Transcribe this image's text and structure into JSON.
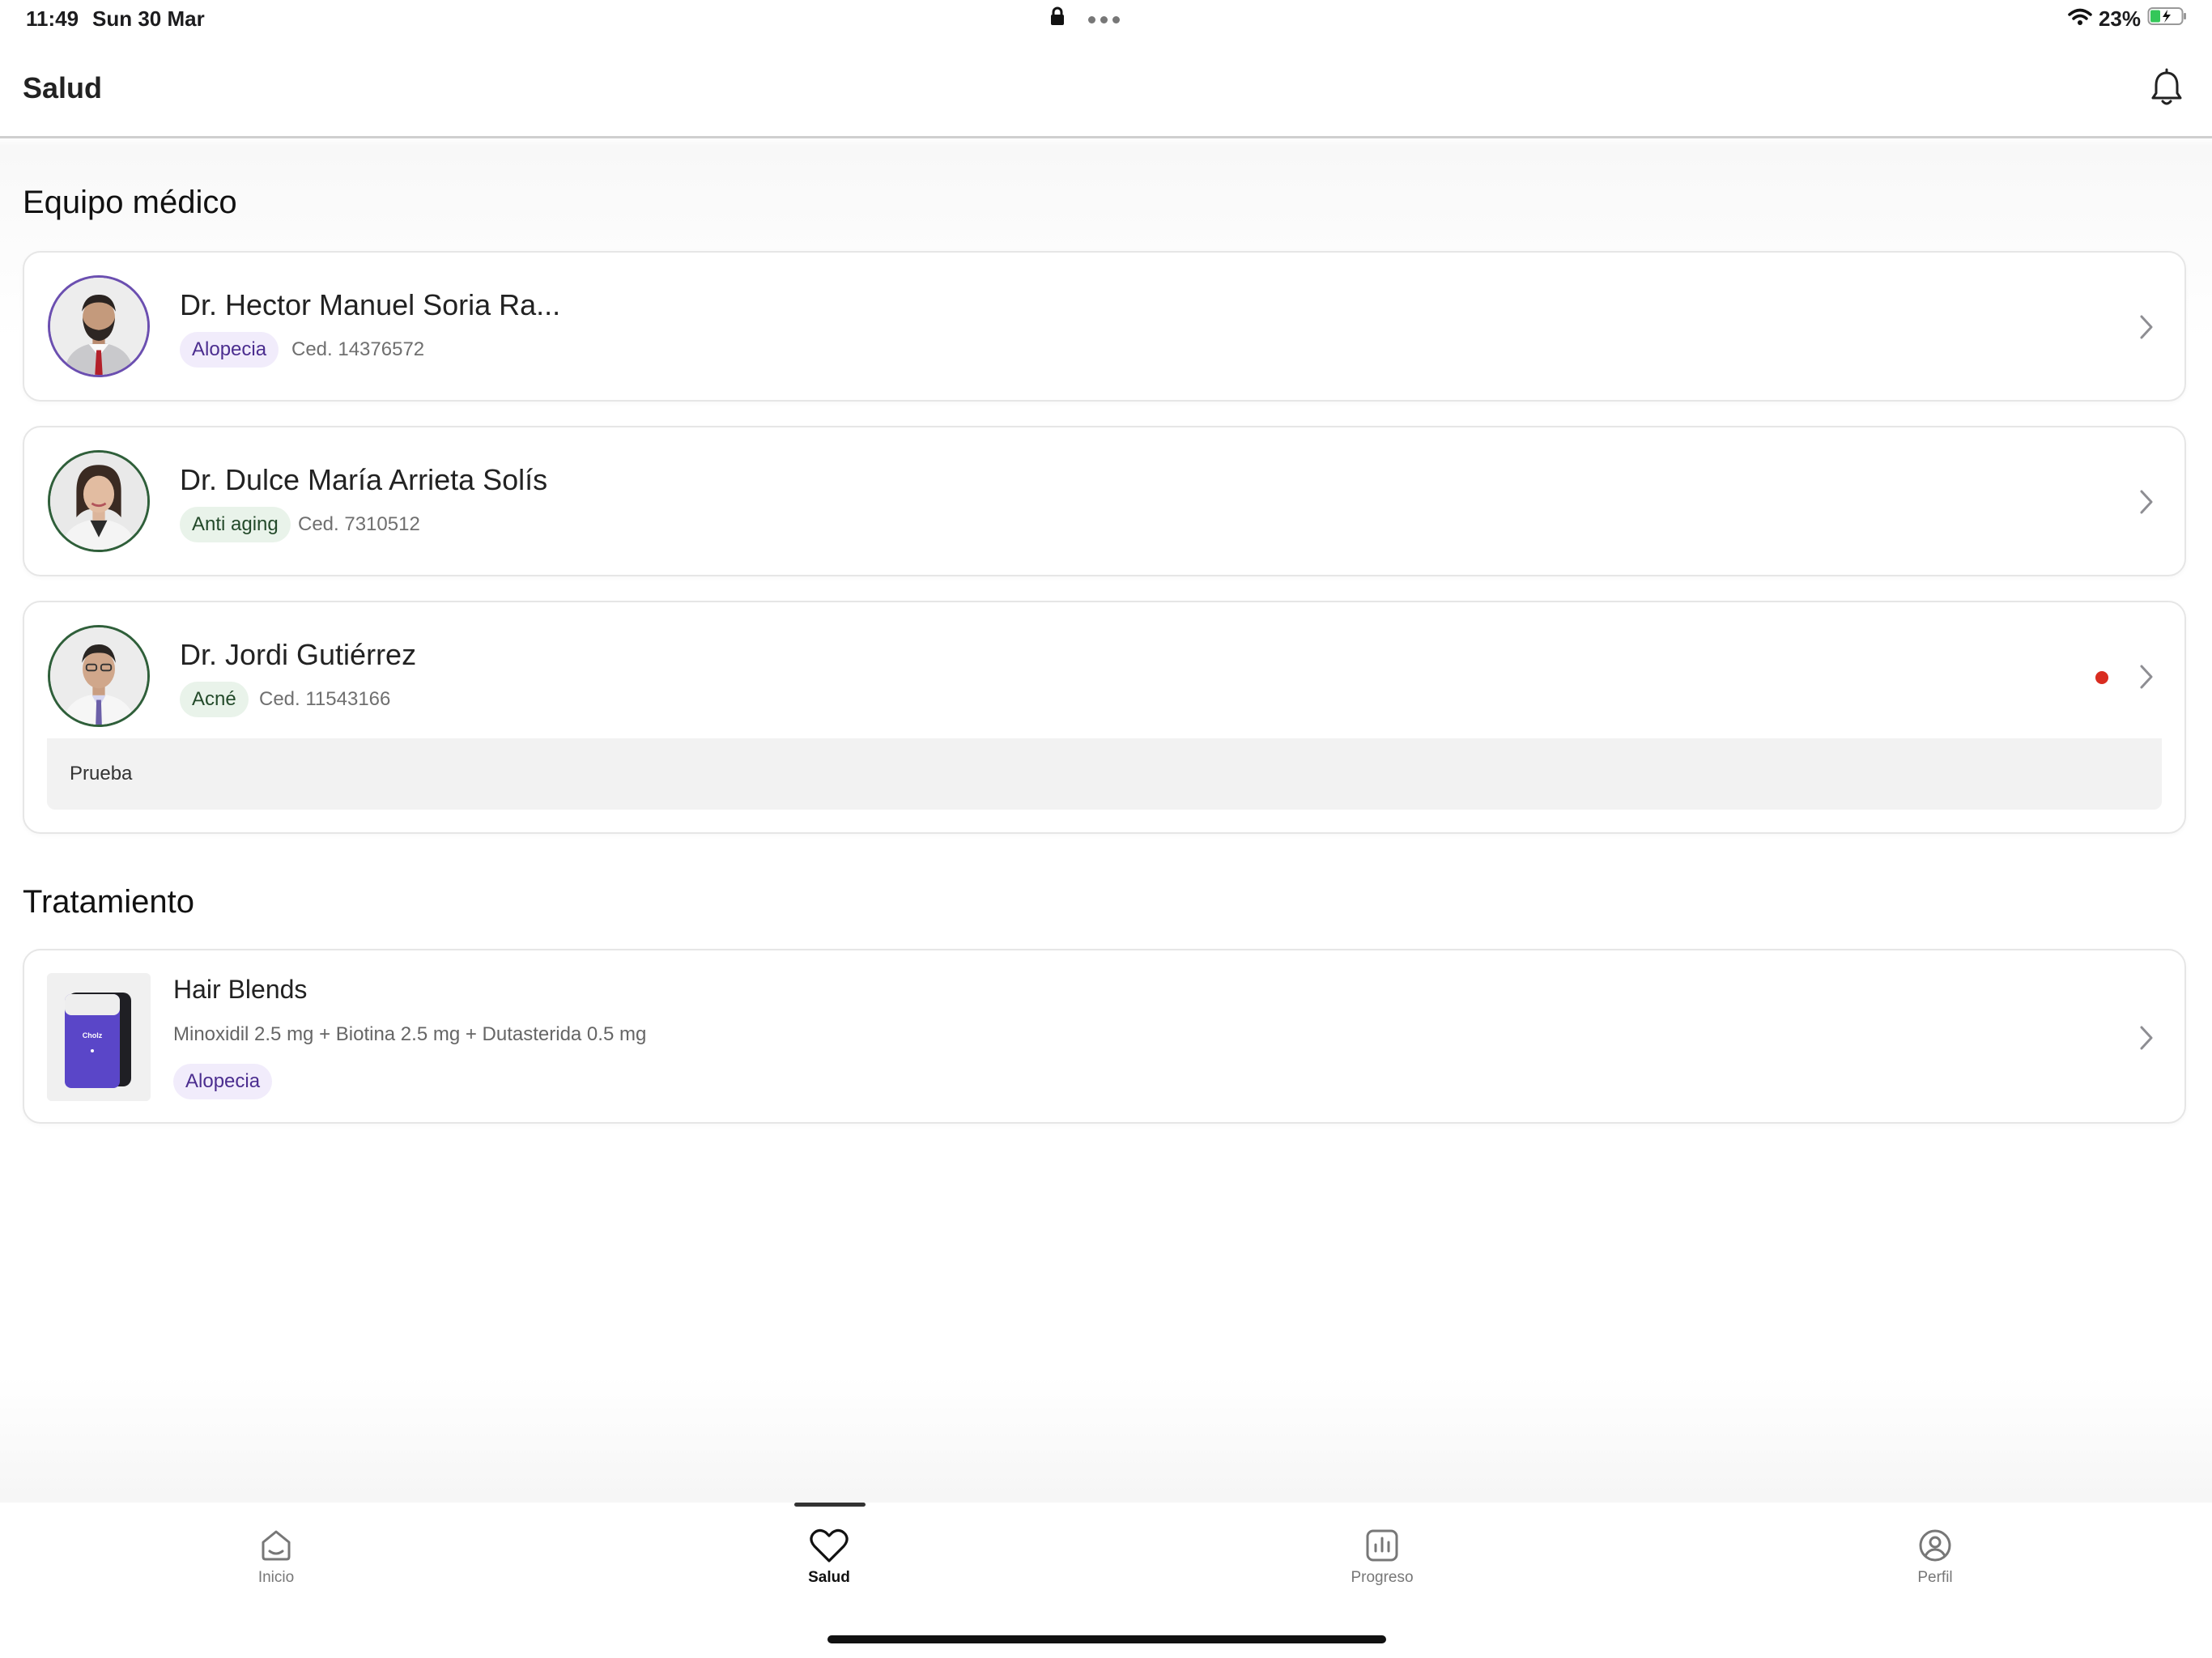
{
  "status_bar": {
    "time": "11:49",
    "date": "Sun 30 Mar",
    "battery": "23%"
  },
  "header": {
    "title": "Salud",
    "notification_icon": "bell-icon"
  },
  "sections": {
    "team_title": "Equipo médico",
    "treatment_title": "Tratamiento"
  },
  "doctors": [
    {
      "name": "Dr. Hector Manuel Soria Ra...",
      "specialty": "Alopecia",
      "license": "Ced. 14376572",
      "tag_color": "purple"
    },
    {
      "name": "Dr. Dulce María Arrieta Solís",
      "specialty": "Anti aging",
      "license": "Ced. 7310512",
      "tag_color": "green"
    },
    {
      "name": "Dr. Jordi Gutiérrez",
      "specialty": "Acné",
      "license": "Ced. 11543166",
      "tag_color": "green",
      "unread": true,
      "message": "Prueba"
    }
  ],
  "treatment": {
    "name": "Hair Blends",
    "description": "Minoxidil 2.5 mg + Biotina 2.5 mg + Dutasterida 0.5 mg",
    "tag": "Alopecia",
    "product_label": "Cholz"
  },
  "bottom_nav": {
    "items": [
      {
        "label": "Inicio",
        "icon": "home-icon"
      },
      {
        "label": "Salud",
        "icon": "heart-icon",
        "active": true
      },
      {
        "label": "Progreso",
        "icon": "chart-icon"
      },
      {
        "label": "Perfil",
        "icon": "profile-icon"
      }
    ]
  },
  "colors": {
    "accent_purple": "#6b4fb0",
    "tag_purple_bg": "#f1ecfb",
    "tag_green_bg": "#e9f3ea",
    "unread_dot": "#d92c20"
  }
}
